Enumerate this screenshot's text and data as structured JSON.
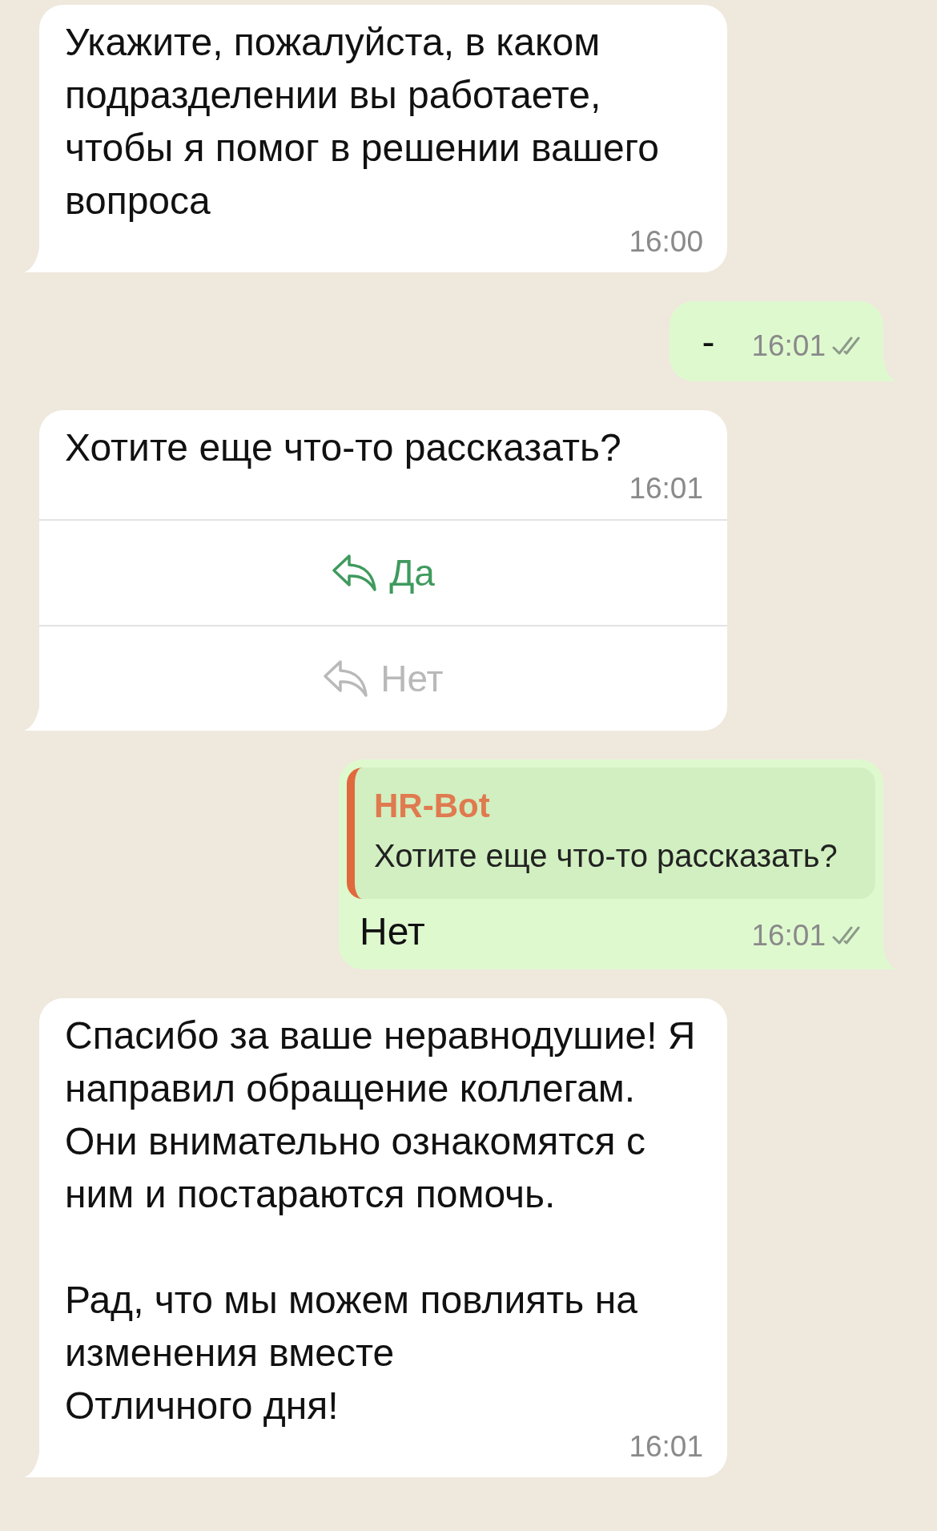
{
  "messages": [
    {
      "kind": "incoming",
      "text": "Укажите, пожалуйста, в каком подразделении вы работаете, чтобы я помог в решении вашего вопроса",
      "time": "16:00"
    },
    {
      "kind": "outgoing",
      "text": "-",
      "time": "16:01",
      "read": false
    },
    {
      "kind": "incoming",
      "text": "Хотите еще что-то рассказать?",
      "time": "16:01",
      "buttons": [
        {
          "label": "Да",
          "disabled": false
        },
        {
          "label": "Нет",
          "disabled": true
        }
      ]
    },
    {
      "kind": "outgoing",
      "quote": {
        "author": "HR-Bot",
        "text": "Хотите еще что-то рассказать?"
      },
      "text": "Нет",
      "time": "16:01",
      "read": false
    },
    {
      "kind": "incoming",
      "text": "Спасибо за ваше неравнодушие! Я направил обращение коллегам. Они внимательно ознакомятся с ним и постараются помочь.\n\nРад, что мы можем повлиять на изменения вместе\nОтличного дня!",
      "time": "16:01"
    }
  ]
}
